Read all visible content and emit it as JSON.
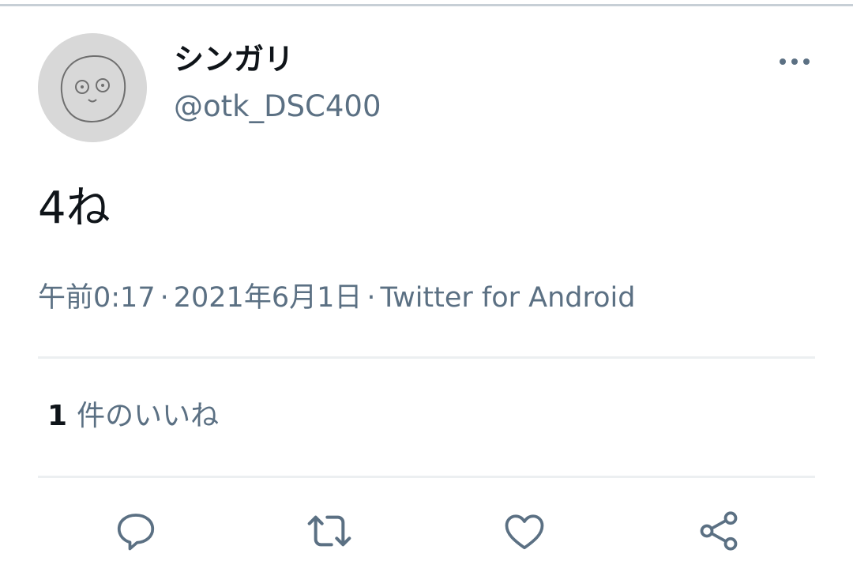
{
  "tweet": {
    "author": {
      "display_name": "シンガリ",
      "handle": "@otk_DSC400",
      "avatar_icon": "face-doodle-avatar"
    },
    "more_icon": "more-horizontal-icon",
    "text": "4ね",
    "meta": {
      "time": "午前0:17",
      "separator": "·",
      "date": "2021年6月1日",
      "source": "Twitter for Android"
    },
    "likes": {
      "count": "1",
      "label": "件のいいね"
    },
    "actions": [
      {
        "name": "reply",
        "icon": "reply-icon"
      },
      {
        "name": "retweet",
        "icon": "retweet-icon"
      },
      {
        "name": "like",
        "icon": "heart-icon"
      },
      {
        "name": "share",
        "icon": "share-icon"
      }
    ]
  },
  "colors": {
    "primary_text": "#0f1419",
    "secondary_text": "#5b7083",
    "divider": "#eceff1",
    "icon": "#5b7083"
  }
}
